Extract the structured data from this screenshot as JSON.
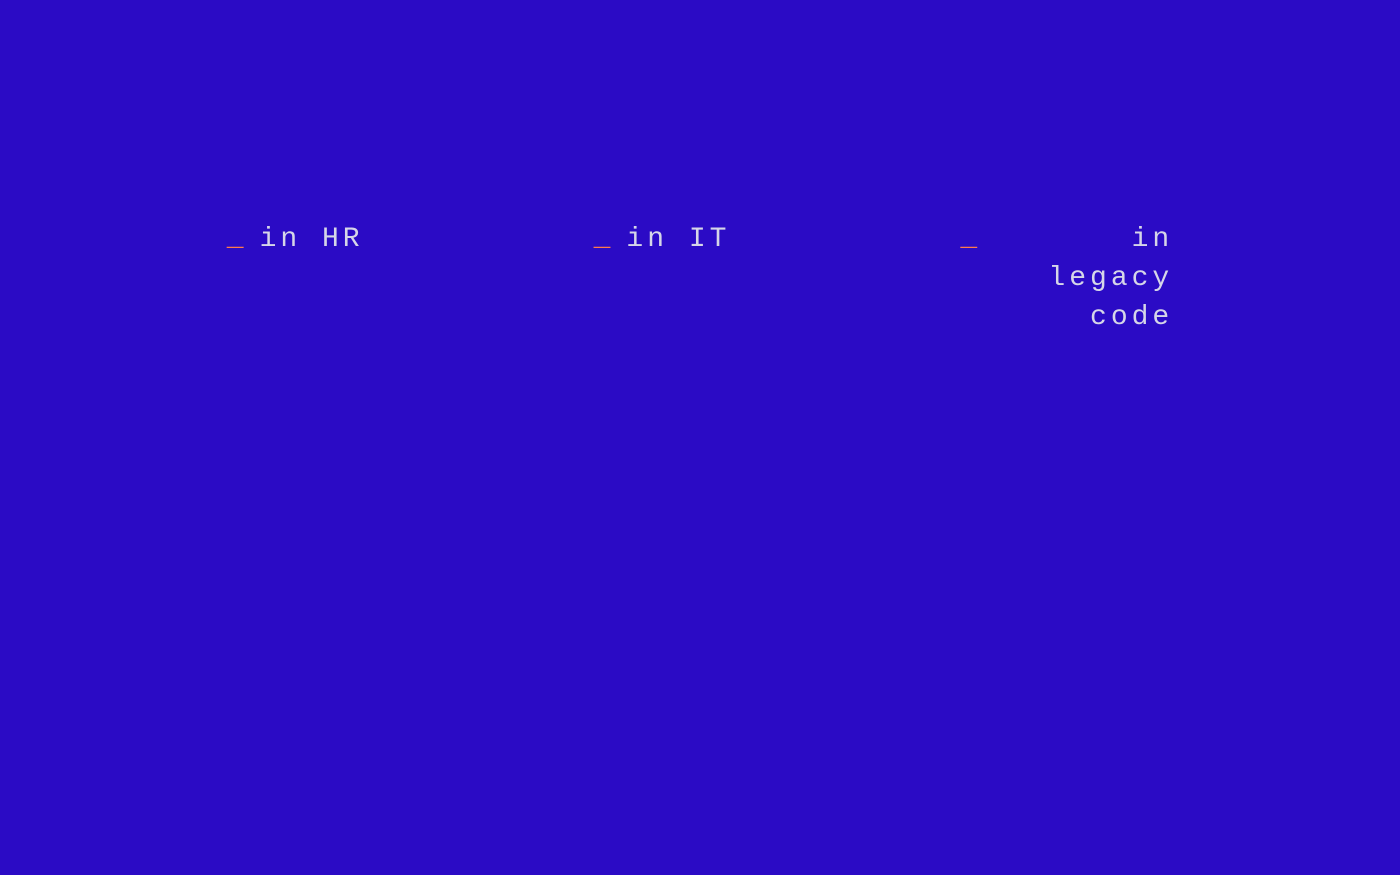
{
  "underscore_glyph": "_",
  "items": [
    {
      "label": "in HR"
    },
    {
      "label": "in IT"
    },
    {
      "label": "in legacy\ncode"
    }
  ],
  "colors": {
    "background": "#2b0bc5",
    "underscore": "#ff7a4d",
    "text": "#d6d6e8"
  }
}
